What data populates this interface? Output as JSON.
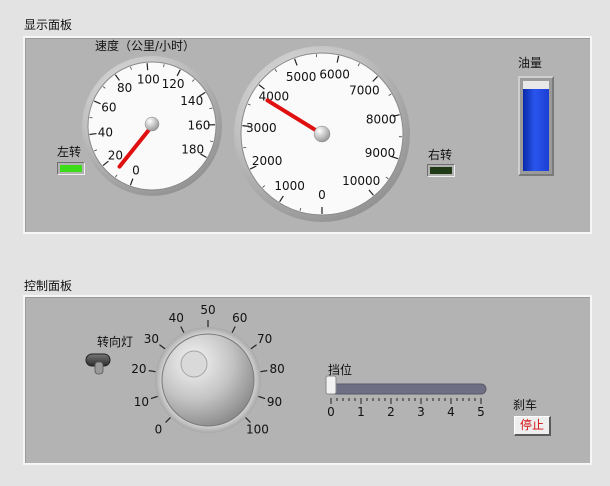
{
  "display": {
    "title": "显示面板",
    "speed": {
      "label": "速度（公里/小时）",
      "ticks": [
        "0",
        "20",
        "40",
        "60",
        "80",
        "100",
        "120",
        "140",
        "160",
        "180"
      ],
      "value": 12
    },
    "rpm": {
      "ticks": [
        "0",
        "1000",
        "2000",
        "3000",
        "4000",
        "5000",
        "6000",
        "7000",
        "8000",
        "9000",
        "10000"
      ],
      "value": 3800
    },
    "left_turn": {
      "label": "左转",
      "color": "#3ddc18"
    },
    "right_turn": {
      "label": "右转",
      "color": "#1f3a14"
    },
    "fuel": {
      "label": "油量",
      "level_percent": 91,
      "color": "#1c3fd4"
    }
  },
  "controls": {
    "title": "控制面板",
    "turn_signal": {
      "label": "转向灯"
    },
    "knob": {
      "ticks": [
        "0",
        "10",
        "20",
        "30",
        "40",
        "50",
        "60",
        "70",
        "80",
        "90",
        "100"
      ],
      "value": 15
    },
    "gear": {
      "label": "挡位",
      "ticks": [
        "0",
        "1",
        "2",
        "3",
        "4",
        "5"
      ],
      "value": 0
    },
    "brake": {
      "label": "刹车",
      "button_label": "停止",
      "text_color": "#d21010"
    }
  }
}
